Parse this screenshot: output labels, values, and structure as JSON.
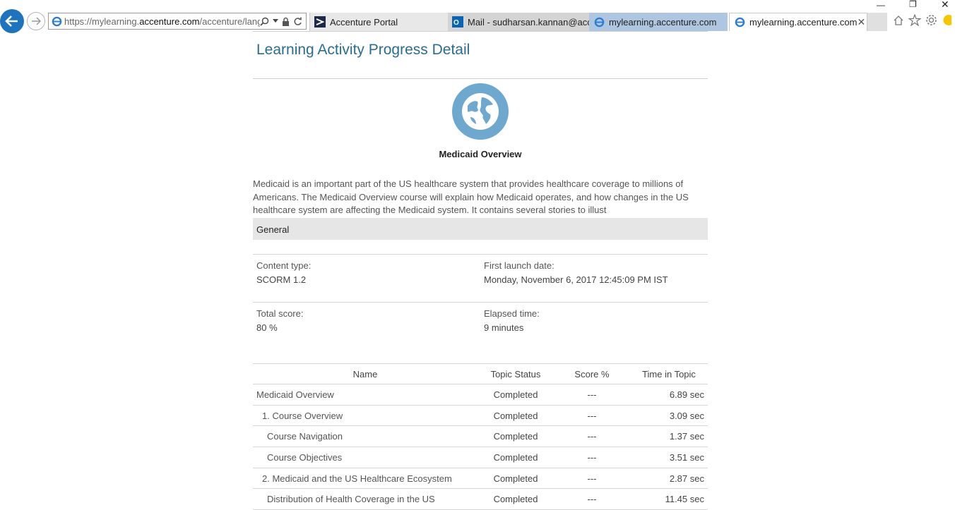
{
  "browser": {
    "url_prefix": "https://mylearning.",
    "url_domain": "accenture.com",
    "url_rest": "/accenture/lang",
    "tabs": [
      {
        "label": "Accenture Portal"
      },
      {
        "label": "Mail - sudharsan.kannan@acc..."
      },
      {
        "label": "mylearning.accenture.com"
      },
      {
        "label": "mylearning.accenture.com"
      }
    ]
  },
  "page": {
    "title": "Learning Activity Progress Detail",
    "course_name": "Medicaid Overview",
    "description": "Medicaid is an important part of the US healthcare system that provides healthcare coverage to millions of Americans. The Medicaid Overview course will explain how Medicaid operates, and how changes in the US healthcare system are affecting the Medicaid system. It contains several stories to illust",
    "section_general": "General",
    "content_type_label": "Content type:",
    "content_type_value": "SCORM 1.2",
    "first_launch_label": "First launch date:",
    "first_launch_value": "Monday, November 6, 2017 12:45:09 PM IST",
    "total_score_label": "Total score:",
    "total_score_value": "80 %",
    "elapsed_label": "Elapsed time:",
    "elapsed_value": "9 minutes"
  },
  "table": {
    "headers": [
      "Name",
      "Topic Status",
      "Score %",
      "Time in Topic"
    ],
    "rows": [
      {
        "name": "Medicaid Overview",
        "status": "Completed",
        "score": "---",
        "time": "6.89 sec"
      },
      {
        "name": "1. Course Overview",
        "status": "Completed",
        "score": "---",
        "time": "3.09 sec"
      },
      {
        "name": "Course Navigation",
        "status": "Completed",
        "score": "---",
        "time": "1.37 sec"
      },
      {
        "name": "Course Objectives",
        "status": "Completed",
        "score": "---",
        "time": "3.51 sec"
      },
      {
        "name": "2. Medicaid and the US Healthcare Ecosystem",
        "status": "Completed",
        "score": "---",
        "time": "2.87 sec"
      },
      {
        "name": "Distribution of Health Coverage in the US",
        "status": "Completed",
        "score": "---",
        "time": "11.45 sec"
      }
    ]
  },
  "colors": {
    "accent": "#2a6d8f",
    "back_button": "#1e73be",
    "icon_circle": "#6ea8cf"
  }
}
